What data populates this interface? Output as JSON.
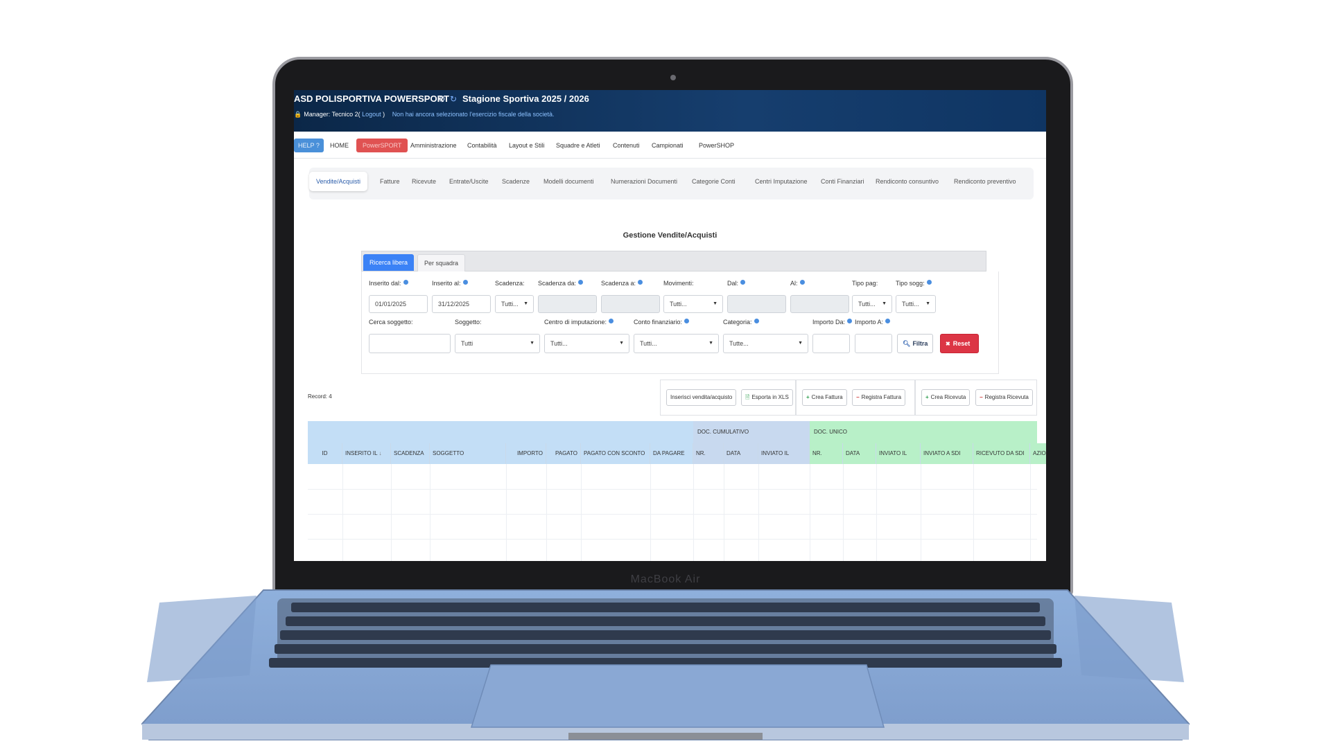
{
  "header": {
    "club_name": "ASD POLISPORTIVA POWERSPORT",
    "gear_icon": "gear-icon",
    "sync_icon": "sync-icon",
    "season": "Stagione Sportiva 2025 / 2026",
    "manager_label": "Manager: Tecnico 2(",
    "logout_label": "Logout",
    "close_paren": ")",
    "notice": "Non hai ancora selezionato l'esercizio fiscale della società."
  },
  "main_nav": {
    "help": "HELP ?",
    "home": "HOME",
    "powersport": "PowerSPORT",
    "items": [
      "Amministrazione",
      "Contabilità",
      "Layout e Stili",
      "Squadre e Atleti",
      "Contenuti",
      "Campionati",
      "PowerSHOP"
    ]
  },
  "sub_nav": {
    "items": [
      "Vendite/Acquisti",
      "Fatture",
      "Ricevute",
      "Entrate/Uscite",
      "Scadenze",
      "Modelli documenti",
      "Numerazioni Documenti",
      "Categorie Conti",
      "Centri Imputazione",
      "Conti Finanziari",
      "Rendiconto consuntivo",
      "Rendiconto preventivo"
    ],
    "active_index": 0
  },
  "page_title": "Gestione Vendite/Acquisti",
  "search": {
    "tabs": [
      "Ricerca libera",
      "Per squadra"
    ],
    "row1": {
      "inserito_dal": {
        "label": "Inserito dal:",
        "value": "01/01/2025"
      },
      "inserito_al": {
        "label": "Inserito al:",
        "value": "31/12/2025"
      },
      "scadenza": {
        "label": "Scadenza:",
        "value": "Tutti..."
      },
      "scadenza_da": {
        "label": "Scadenza da:",
        "value": ""
      },
      "scadenza_a": {
        "label": "Scadenza a:",
        "value": ""
      },
      "movimenti": {
        "label": "Movimenti:",
        "value": "Tutti..."
      },
      "dal": {
        "label": "Dal:",
        "value": ""
      },
      "al": {
        "label": "Al:",
        "value": ""
      },
      "tipo_pag": {
        "label": "Tipo pag:",
        "value": "Tutti..."
      },
      "tipo_sogg": {
        "label": "Tipo sogg:",
        "value": "Tutti..."
      }
    },
    "row2": {
      "cerca_soggetto": {
        "label": "Cerca soggetto:",
        "value": ""
      },
      "soggetto": {
        "label": "Soggetto:",
        "value": "Tutti"
      },
      "centro": {
        "label": "Centro di imputazione:",
        "value": "Tutti..."
      },
      "conto": {
        "label": "Conto finanziario:",
        "value": "Tutti..."
      },
      "categoria": {
        "label": "Categoria:",
        "value": "Tutte..."
      },
      "importo_da": {
        "label": "Importo Da:",
        "value": ""
      },
      "importo_a": {
        "label": "Importo A:",
        "value": ""
      }
    },
    "filter_button": "Filtra",
    "reset_button": "Reset"
  },
  "toolbar": {
    "records": "Record: 4",
    "inserisci": "Inserisci vendita/acquisto",
    "esporta": "Esporta in XLS",
    "crea_fattura": "Crea Fattura",
    "registra_fattura": "Registra Fattura",
    "crea_ricevuta": "Crea Ricevuta",
    "registra_ricevuta": "Registra Ricevuta"
  },
  "table": {
    "group_cumulativo": "DOC. CUMULATIVO",
    "group_unico": "DOC. UNICO",
    "columns": [
      "ID",
      "INSERITO IL",
      "SCADENZA",
      "SOGGETTO",
      "IMPORTO",
      "PAGATO",
      "PAGATO CON SCONTO",
      "DA PAGARE",
      "NR.",
      "DATA",
      "INVIATO IL",
      "NR.",
      "DATA",
      "INVIATO IL",
      "INVIATO A SDI",
      "RICEVUTO DA SDI",
      "AZIONI"
    ],
    "sort_indicator": "↓",
    "colors": {
      "main": "#c3def6",
      "cumulativo": "#c8d9ef",
      "unico": "#b8f0c8"
    }
  },
  "device": {
    "brand": "MacBook Air"
  }
}
